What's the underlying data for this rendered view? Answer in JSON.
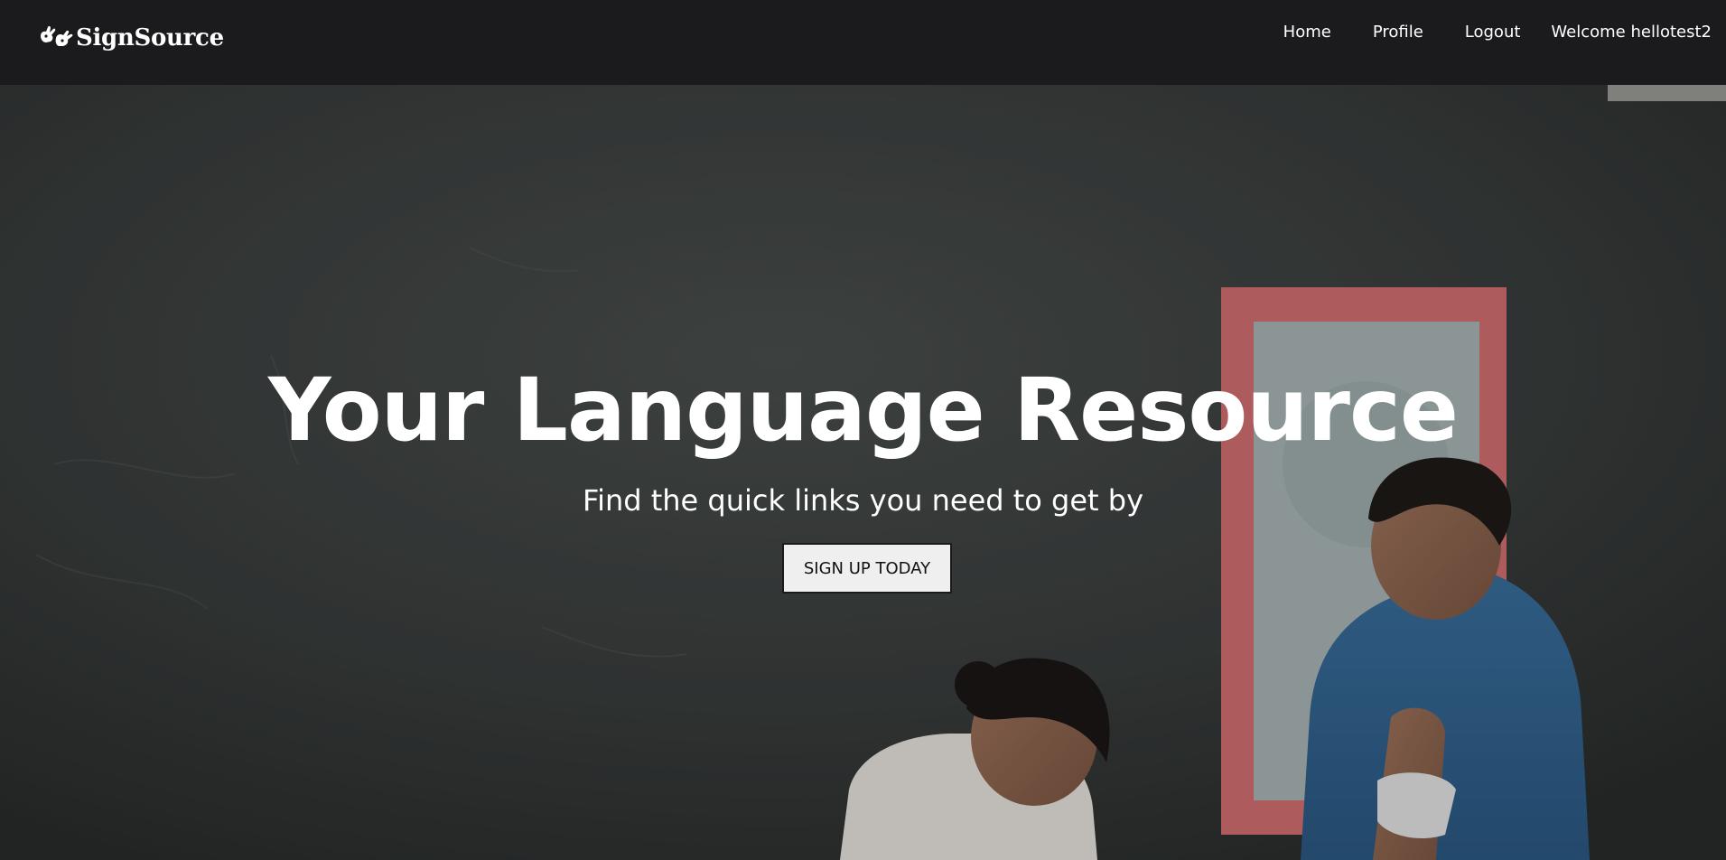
{
  "navbar": {
    "brand": {
      "logo_icon": "hands-sign-icon",
      "name": "SignSource"
    },
    "links": [
      {
        "label": "Home"
      },
      {
        "label": "Profile"
      },
      {
        "label": "Logout"
      }
    ],
    "welcome_text": "Welcome hellotest2"
  },
  "hero": {
    "title": "Your Language Resource",
    "subtitle": "Find the quick links you need to get by",
    "cta_label": "SIGN UP TODAY"
  },
  "colors": {
    "navbar_bg": "#1b1a1c",
    "hero_bg": "#363a39",
    "cta_bg": "#efefef",
    "text": "#ffffff"
  }
}
